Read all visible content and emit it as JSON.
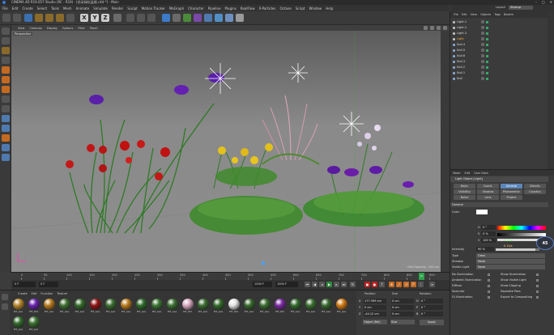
{
  "window": {
    "title": "CINEMA 4D R19.057 Studio (RC - R19) - [花朵绿化盆栽.c4d *] - Main"
  },
  "menubar": [
    "File",
    "Edit",
    "Create",
    "Select",
    "Tools",
    "Mesh",
    "Animate",
    "Simulate",
    "Render",
    "Sculpt",
    "Motion Tracker",
    "MoGraph",
    "Character",
    "Pipeline",
    "Plugins",
    "RealFlow",
    "X-Particles",
    "Octane",
    "Script",
    "Window",
    "Help"
  ],
  "toolbar": {
    "axis_labels": [
      "X",
      "Y",
      "Z"
    ]
  },
  "layout": {
    "label": "Layout",
    "value": "Startup"
  },
  "viewport": {
    "menu": [
      "View",
      "Cameras",
      "Display",
      "Options",
      "Filter",
      "Panel"
    ],
    "camera": "Perspective",
    "grid_spacing": "Grid Spacing : 100 cm"
  },
  "timeline": {
    "ticks": [
      "0",
      "50",
      "100",
      "150",
      "200",
      "250",
      "300",
      "350",
      "400",
      "450",
      "500",
      "550",
      "600",
      "650",
      "700",
      "750",
      "800",
      "850",
      "900"
    ],
    "current_frame": "4?"
  },
  "playback": {
    "start": "0 F",
    "min": "0 F",
    "end": "1000 F",
    "max": "1000 F"
  },
  "material_manager": {
    "menu": [
      "Create",
      "Edit",
      "Function",
      "Texture"
    ],
    "materials": [
      {
        "label": "MT_Lea",
        "color": "#b5852a"
      },
      {
        "label": "MT_Pet",
        "color": "#6a24b0"
      },
      {
        "label": "MT_Lea",
        "color": "#b87a1e"
      },
      {
        "label": "MT_Lea",
        "color": "#3f6e30"
      },
      {
        "label": "MT_Lea",
        "color": "#356a2c"
      },
      {
        "label": "MT_Lea",
        "color": "#8f1414"
      },
      {
        "label": "MT_Lea",
        "color": "#3a6c2e"
      },
      {
        "label": "MT_Lea",
        "color": "#b87a1e"
      },
      {
        "label": "MT_Lea",
        "color": "#2f6a2a"
      },
      {
        "label": "MT_Lea",
        "color": "#3b7233"
      },
      {
        "label": "MT_Lea",
        "color": "#3d6f33"
      },
      {
        "label": "MT_Pet",
        "color": "#d8a8c0"
      },
      {
        "label": "MT_Lea",
        "color": "#3a6b30"
      },
      {
        "label": "MT_Lea",
        "color": "#356a2c"
      },
      {
        "label": "MT_Pet",
        "color": "#e2e2e2"
      },
      {
        "label": "MT_Lea",
        "color": "#36682d"
      },
      {
        "label": "MT_Lea",
        "color": "#3b6c31"
      },
      {
        "label": "MT_Pet",
        "color": "#7a2aa0"
      },
      {
        "label": "MT_Lea",
        "color": "#346a2c"
      },
      {
        "label": "MT_Lea",
        "color": "#3a6e2f"
      },
      {
        "label": "MT_Lea",
        "color": "#38682e"
      },
      {
        "label": "MT_Lea",
        "color": "#d07a16"
      },
      {
        "label": "MT_Lea",
        "color": "#336a2c"
      },
      {
        "label": "MT_Lea",
        "color": "#3b6f31"
      }
    ]
  },
  "coordinates": {
    "headers": [
      "Position",
      "Size",
      "Rotation"
    ],
    "rows": [
      {
        "axis": "X",
        "pos": "177.399 cm",
        "size": "0 cm",
        "rlabel": "H",
        "rot": "0 °"
      },
      {
        "axis": "Y",
        "pos": "0 cm",
        "size": "0 cm",
        "rlabel": "P",
        "rot": "0 °"
      },
      {
        "axis": "Z",
        "pos": "-44.12 cm",
        "size": "0 cm",
        "rlabel": "B",
        "rot": "0 °"
      }
    ],
    "mode": "Object (Rel)",
    "size_mode": "Size",
    "apply": "Apply"
  },
  "object_manager": {
    "menu": [
      "File",
      "Edit",
      "View",
      "Objects",
      "Tags",
      "Bookm"
    ],
    "objects": [
      "Light.1",
      "Light.2",
      "Light.3",
      "Light",
      "Null.4",
      "Null.5",
      "Null.6",
      "Null.3",
      "Null.2",
      "Null.1",
      "Null"
    ]
  },
  "attributes": {
    "menu": [
      "Mode",
      "Edit",
      "User Data"
    ],
    "object_title": "Light Object [Light]",
    "tabs_row1": [
      "Basic",
      "Coord.",
      "General",
      "Details"
    ],
    "tabs_row2": [
      "Visibility",
      "Shadow",
      "Photometric",
      "Caustics"
    ],
    "tabs_row3": [
      "Noise",
      "Lens",
      "Project"
    ],
    "active_tab": "General",
    "section": "General",
    "color_label": "Color",
    "h_label": "H",
    "h_val": "0 °",
    "s_label": "S",
    "s_val": "0 %",
    "v_label": "V",
    "v_val": "100 %",
    "intensity_label": "Intensity",
    "intensity": "90 %",
    "type_label": "Type",
    "type": "Omni",
    "shadow_label": "Shadow",
    "shadow": "None",
    "visible_light_label": "Visible Light",
    "visible_light": "None",
    "checks_left": [
      "No Illumination",
      "Ambient Illumination",
      "Diffuse",
      "Specular",
      "GI Illumination"
    ],
    "checks_right": [
      "Show Illumination",
      "Show Visible Light",
      "Show Clipping",
      "Separate Pass",
      "Export to Compositing"
    ],
    "speed_up": "0.1k/s",
    "speed_down": "0.1k/s",
    "cpu_badge": "45"
  }
}
